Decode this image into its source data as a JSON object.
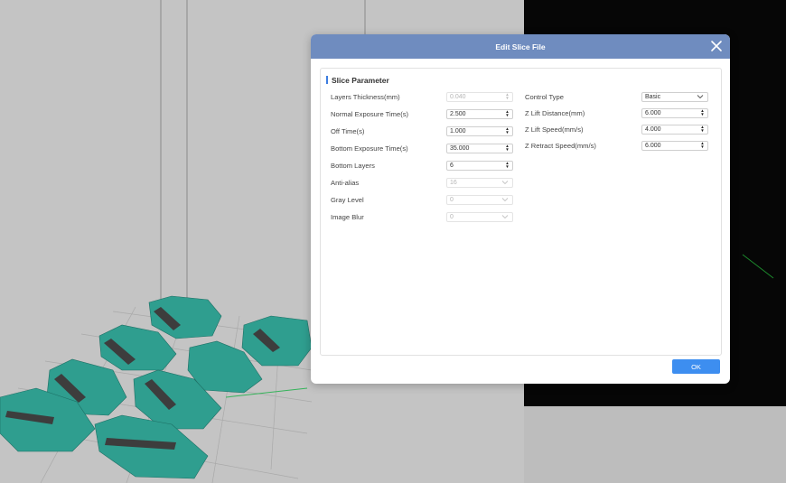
{
  "dialog": {
    "title": "Edit Slice File",
    "section_title": "Slice Parameter",
    "ok_label": "OK"
  },
  "left_params": [
    {
      "label": "Layers Thickness(mm)",
      "value": "0.040",
      "control": "spin",
      "enabled": false
    },
    {
      "label": "Normal Exposure Time(s)",
      "value": "2.500",
      "control": "spin",
      "enabled": true
    },
    {
      "label": "Off Time(s)",
      "value": "1.000",
      "control": "spin",
      "enabled": true
    },
    {
      "label": "Bottom Exposure Time(s)",
      "value": "35.000",
      "control": "spin",
      "enabled": true
    },
    {
      "label": "Bottom Layers",
      "value": "6",
      "control": "spin",
      "enabled": true
    },
    {
      "label": "Anti-alias",
      "value": "16",
      "control": "select",
      "enabled": false
    },
    {
      "label": "Gray Level",
      "value": "0",
      "control": "select",
      "enabled": false
    },
    {
      "label": "Image Blur",
      "value": "0",
      "control": "select",
      "enabled": false
    }
  ],
  "right_params": [
    {
      "label": "Control Type",
      "value": "Basic",
      "control": "select",
      "enabled": true
    },
    {
      "label": "Z Lift Distance(mm)",
      "value": "6.000",
      "control": "spin",
      "enabled": true
    },
    {
      "label": "Z Lift Speed(mm/s)",
      "value": "4.000",
      "control": "spin",
      "enabled": true
    },
    {
      "label": "Z Retract Speed(mm/s)",
      "value": "6.000",
      "control": "spin",
      "enabled": true
    }
  ],
  "colors": {
    "titlebar": "#6f8cbf",
    "accent": "#3d7de0",
    "ok_button": "#3d8ef0",
    "model_teal": "#2f9e8f"
  }
}
